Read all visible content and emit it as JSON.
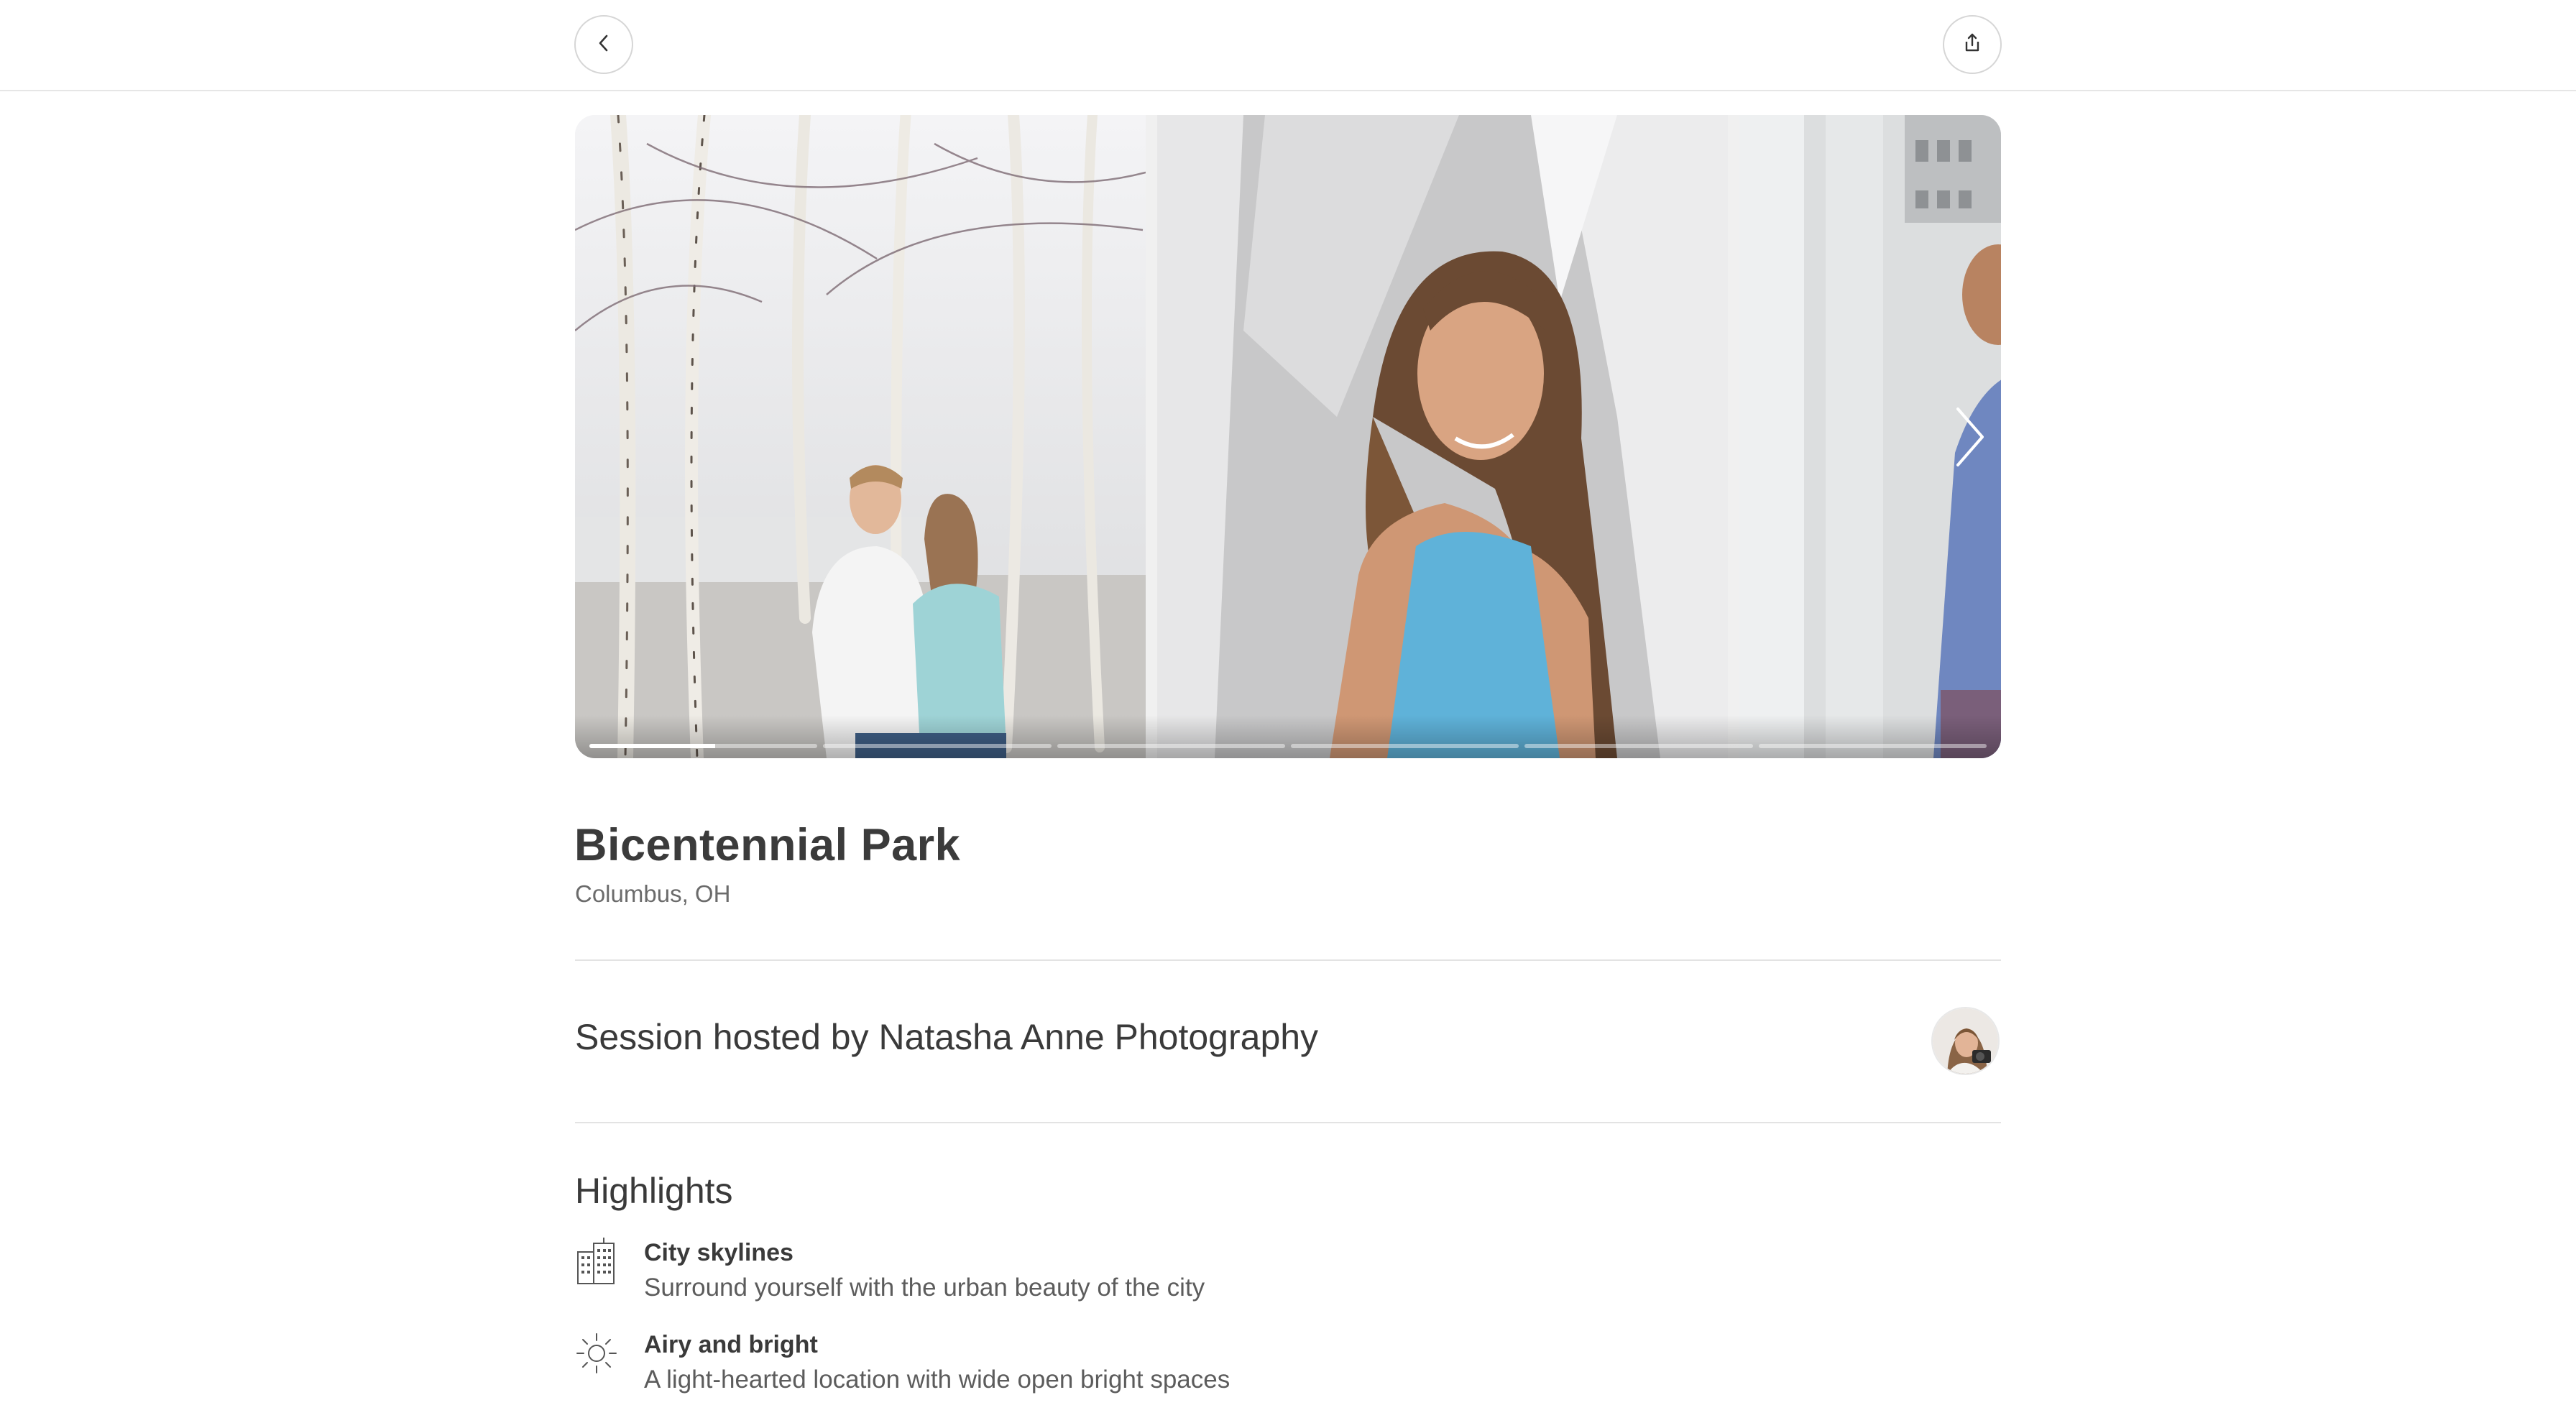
{
  "header": {
    "back_icon": "chevron-left-icon",
    "share_icon": "share-icon"
  },
  "gallery": {
    "photos": [
      {
        "description_icon": "photo",
        "subject": "couple embracing among birch trees"
      },
      {
        "description_icon": "photo",
        "subject": "woman in blue tank top"
      },
      {
        "description_icon": "photo",
        "subject": "person in blue shirt near columns"
      }
    ],
    "progress": {
      "segments": 6,
      "active_index": 0,
      "active_fill": 0.55
    },
    "next_icon": "chevron-right-icon"
  },
  "location": {
    "name": "Bicentennial Park",
    "city": "Columbus, OH"
  },
  "host": {
    "text": "Session hosted by Natasha Anne Photography"
  },
  "highlights": {
    "title": "Highlights",
    "items": [
      {
        "icon": "city-building-icon",
        "title": "City skylines",
        "description": "Surround yourself with the urban beauty of the city"
      },
      {
        "icon": "sun-icon",
        "title": "Airy and bright",
        "description": "A light-hearted location with wide open bright spaces"
      }
    ]
  },
  "colors": {
    "text_primary": "#3b3b3b",
    "text_secondary": "#6b6b6b",
    "divider": "#e3e3e3"
  }
}
